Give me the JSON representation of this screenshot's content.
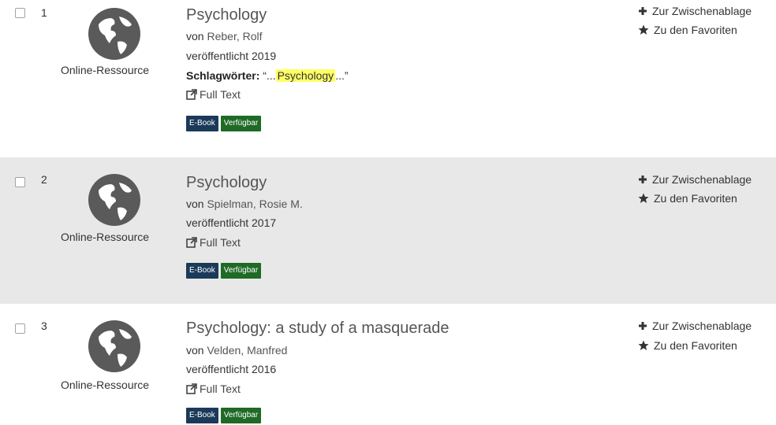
{
  "results": [
    {
      "number": "1",
      "format": "Online-Ressource",
      "title": "Psychology",
      "by_prefix": "von",
      "author": "Reber, Rolf",
      "published": "veröffentlicht 2019",
      "keywords_label": "Schlagwörter:",
      "keywords_prefix": "“...",
      "keywords_highlight": "Psychology",
      "keywords_suffix": "...”",
      "full_text": "Full Text",
      "badge_type": "E-Book",
      "badge_status": "Verfügbar",
      "add_clipboard": "Zur Zwischenablage",
      "add_favorites": "Zu den Favoriten"
    },
    {
      "number": "2",
      "format": "Online-Ressource",
      "title": "Psychology",
      "by_prefix": "von",
      "author": "Spielman, Rosie M.",
      "published": "veröffentlicht 2017",
      "full_text": "Full Text",
      "badge_type": "E-Book",
      "badge_status": "Verfügbar",
      "add_clipboard": "Zur Zwischenablage",
      "add_favorites": "Zu den Favoriten"
    },
    {
      "number": "3",
      "format": "Online-Ressource",
      "title": "Psychology: a study of a masquerade",
      "by_prefix": "von",
      "author": "Velden, Manfred",
      "published": "veröffentlicht 2016",
      "full_text": "Full Text",
      "badge_type": "E-Book",
      "badge_status": "Verfügbar",
      "add_clipboard": "Zur Zwischenablage",
      "add_favorites": "Zu den Favoriten"
    }
  ],
  "colors": {
    "highlight": "#ffff66",
    "badge_ebook": "#1b3a5a",
    "badge_available": "#1e6a26",
    "row_shaded": "#e8e8e8"
  },
  "icons": {
    "format": "globe-icon",
    "full_text": "external-link-icon",
    "clipboard": "plus-icon",
    "favorites": "star-icon"
  }
}
